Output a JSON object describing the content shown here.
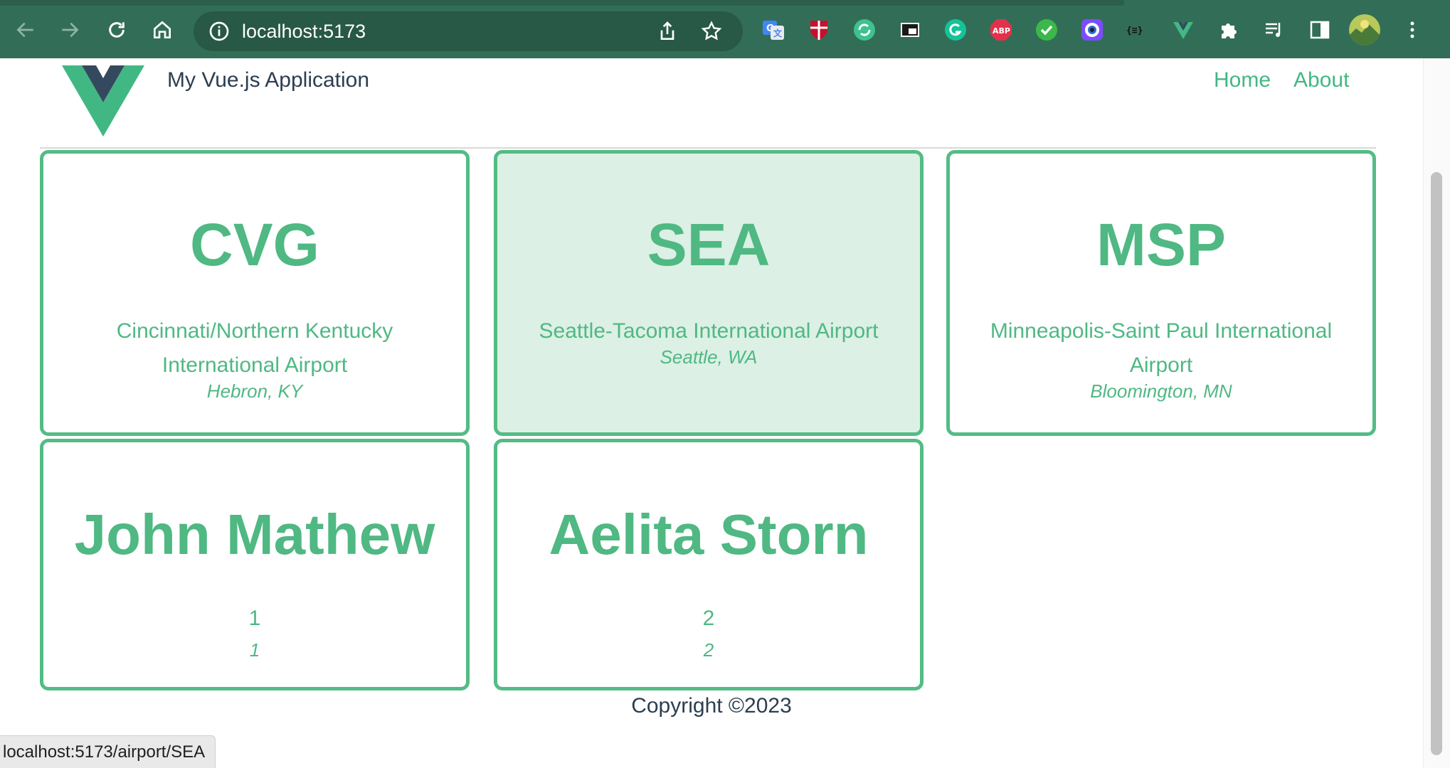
{
  "browser": {
    "url": "localhost:5173",
    "status_url": "localhost:5173/airport/SEA",
    "extensions": [
      "google-translate-icon",
      "shield-crest-icon",
      "sync-icon",
      "picture-in-picture-icon",
      "grammarly-icon",
      "adblock-plus-icon",
      "checkmark-icon",
      "color-picker-icon",
      "json-viewer-icon",
      "vue-devtools-icon",
      "puzzle-piece-icon",
      "media-playlist-icon",
      "side-panel-icon",
      "profile-avatar"
    ],
    "abp_label": "ABP",
    "json_label": "{≡}"
  },
  "header": {
    "title": "My Vue.js Application",
    "nav": [
      "Home",
      "About"
    ]
  },
  "airports": [
    {
      "code": "CVG",
      "name": "Cincinnati/Northern Kentucky International Airport",
      "location": "Hebron, KY"
    },
    {
      "code": "SEA",
      "name": "Seattle-Tacoma International Airport",
      "location": "Seattle, WA"
    },
    {
      "code": "MSP",
      "name": "Minneapolis-Saint Paul International Airport",
      "location": "Bloomington, MN"
    }
  ],
  "people": [
    {
      "name": "John Mathew",
      "id": "1",
      "id_italic": "1"
    },
    {
      "name": "Aelita Storn",
      "id": "2",
      "id_italic": "2"
    }
  ],
  "footer": {
    "copyright": "Copyright ©2023"
  },
  "colors": {
    "accent": "#42b883",
    "toolbar": "#326e57",
    "hover_card": "#dcf0e5",
    "text_dark": "#2c3e50"
  }
}
